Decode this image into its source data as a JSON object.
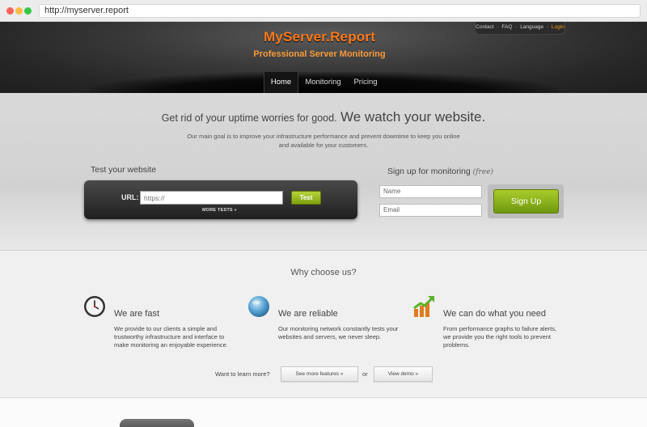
{
  "browser": {
    "url": "http://myserver.report"
  },
  "toplinks": {
    "contact": "Contact",
    "faq": "FAQ",
    "language": "Language",
    "login": "Login",
    "separator": "-"
  },
  "header": {
    "brand": "MyServer.Report",
    "tagline": "Professional Server Monitoring"
  },
  "nav": {
    "items": [
      {
        "label": "Home"
      },
      {
        "label": "Monitoring"
      },
      {
        "label": "Pricing"
      }
    ]
  },
  "hero": {
    "headline_small": "Get rid of your uptime worries for good.",
    "headline_big": "We watch your website.",
    "subtext": "Our main goal is to improve your infrastructure performance and prevent downtime to keep you online and available for your customers."
  },
  "test": {
    "title": "Test your website",
    "url_label": "URL:",
    "url_placeholder": "https://",
    "button": "Test",
    "more_tests": "MORE TESTS »"
  },
  "signup": {
    "title": "Sign up for monitoring",
    "free": "(free)",
    "name_placeholder": "Name",
    "email_placeholder": "Email",
    "button": "Sign Up"
  },
  "features": {
    "heading": "Why choose us?",
    "items": [
      {
        "title": "We are fast",
        "icon": "clock-icon",
        "desc": "We provide to our clients a simple and trustworthy infrastructure and interface to make monitoring an enjoyable experience."
      },
      {
        "title": "We are reliable",
        "icon": "globe-icon",
        "desc": "Our monitoring network constantly tests your websites and servers, we never sleep."
      },
      {
        "title": "We can do what you need",
        "icon": "growth-chart-icon",
        "desc": "From performance graphs to failure alerts, we provide you the right tools to prevent problems."
      }
    ],
    "learn_more": "Want to learn more?",
    "see_more": "See more features »",
    "or": "or",
    "view_demo": "View demo »"
  }
}
